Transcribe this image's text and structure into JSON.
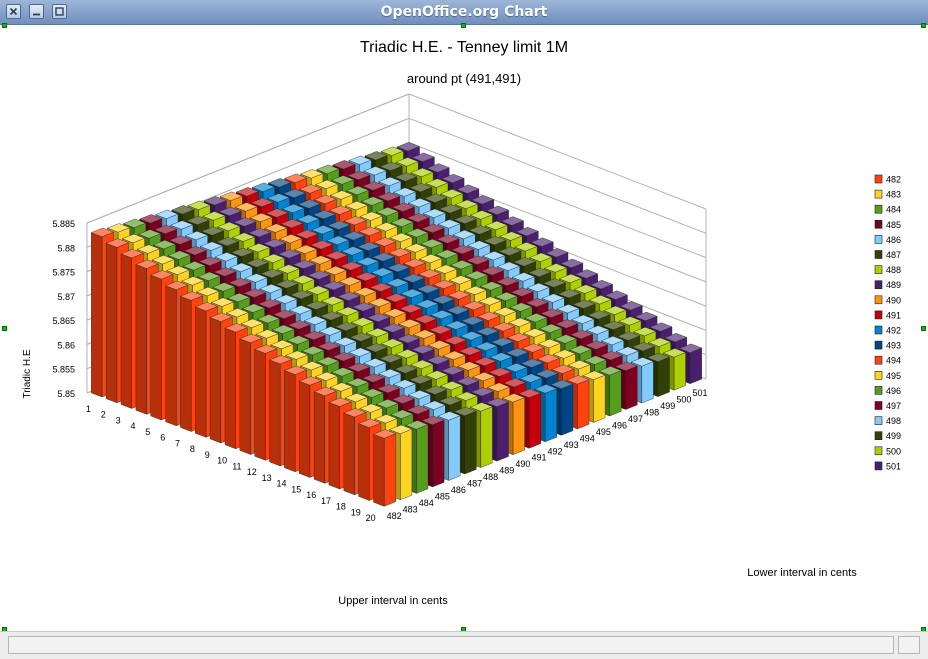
{
  "window": {
    "title": "OpenOffice.org Chart"
  },
  "chart_data": {
    "type": "bar",
    "title": "Triadic H.E. - Tenney limit 1M",
    "subtitle": "around pt (491,491)",
    "ylabel": "Triadic H.E",
    "xlabel": "Upper interval in cents",
    "zlabel": "Lower interval in cents",
    "ylim": [
      5.85,
      5.885
    ],
    "yticks": [
      "5.85",
      "5.855",
      "5.86",
      "5.865",
      "5.87",
      "5.875",
      "5.88",
      "5.885"
    ],
    "rows": [
      "1",
      "2",
      "3",
      "4",
      "5",
      "6",
      "7",
      "8",
      "9",
      "10",
      "11",
      "12",
      "13",
      "14",
      "15",
      "16",
      "17",
      "18",
      "19",
      "20"
    ],
    "series": [
      {
        "name": "482",
        "color": "#ff420e",
        "values": [
          5.883,
          5.882,
          5.881,
          5.88,
          5.879,
          5.878,
          5.877,
          5.876,
          5.875,
          5.874,
          5.873,
          5.872,
          5.871,
          5.87,
          5.869,
          5.868,
          5.867,
          5.866,
          5.865,
          5.864
        ]
      },
      {
        "name": "483",
        "color": "#ffd320",
        "values": [
          5.8826,
          5.8816,
          5.8806,
          5.8796,
          5.8786,
          5.8776,
          5.8766,
          5.8756,
          5.8746,
          5.8736,
          5.8726,
          5.8716,
          5.8706,
          5.8696,
          5.8686,
          5.8676,
          5.8666,
          5.8656,
          5.8646,
          5.8636
        ]
      },
      {
        "name": "484",
        "color": "#579d1c",
        "values": [
          5.8822,
          5.8812,
          5.8802,
          5.8792,
          5.8782,
          5.8772,
          5.8762,
          5.8752,
          5.8742,
          5.8732,
          5.8722,
          5.8712,
          5.8702,
          5.8692,
          5.8682,
          5.8672,
          5.8662,
          5.8652,
          5.8642,
          5.8632
        ]
      },
      {
        "name": "485",
        "color": "#7e0021",
        "values": [
          5.8818,
          5.8808,
          5.8798,
          5.8788,
          5.8778,
          5.8768,
          5.8758,
          5.8748,
          5.8738,
          5.8728,
          5.8718,
          5.8708,
          5.8698,
          5.8688,
          5.8678,
          5.8668,
          5.8658,
          5.8648,
          5.8638,
          5.8628
        ]
      },
      {
        "name": "486",
        "color": "#83caff",
        "values": [
          5.8814,
          5.8804,
          5.8794,
          5.8784,
          5.8774,
          5.8764,
          5.8754,
          5.8744,
          5.8734,
          5.8724,
          5.8714,
          5.8704,
          5.8694,
          5.8684,
          5.8674,
          5.8664,
          5.8654,
          5.8644,
          5.8634,
          5.8624
        ]
      },
      {
        "name": "487",
        "color": "#314004",
        "values": [
          5.881,
          5.88,
          5.879,
          5.878,
          5.877,
          5.876,
          5.875,
          5.874,
          5.873,
          5.872,
          5.871,
          5.87,
          5.869,
          5.868,
          5.867,
          5.866,
          5.865,
          5.864,
          5.863,
          5.862
        ]
      },
      {
        "name": "488",
        "color": "#aecf00",
        "values": [
          5.8806,
          5.8796,
          5.8786,
          5.8776,
          5.8766,
          5.8756,
          5.8746,
          5.8736,
          5.8726,
          5.8716,
          5.8706,
          5.8696,
          5.8686,
          5.8676,
          5.8666,
          5.8656,
          5.8646,
          5.8636,
          5.8626,
          5.8616
        ]
      },
      {
        "name": "489",
        "color": "#4b1f6f",
        "values": [
          5.8802,
          5.8792,
          5.8782,
          5.8772,
          5.8762,
          5.8752,
          5.8742,
          5.8732,
          5.8722,
          5.8712,
          5.8702,
          5.8692,
          5.8682,
          5.8672,
          5.8662,
          5.8652,
          5.8642,
          5.8632,
          5.8622,
          5.8612
        ]
      },
      {
        "name": "490",
        "color": "#ff950e",
        "values": [
          5.8798,
          5.8788,
          5.8778,
          5.8768,
          5.8758,
          5.8748,
          5.8738,
          5.8728,
          5.8718,
          5.8708,
          5.8698,
          5.8688,
          5.8678,
          5.8668,
          5.8658,
          5.8648,
          5.8638,
          5.8628,
          5.8618,
          5.8608
        ]
      },
      {
        "name": "491",
        "color": "#c5000b",
        "values": [
          5.8794,
          5.8784,
          5.8774,
          5.8764,
          5.8754,
          5.8744,
          5.8734,
          5.8724,
          5.8714,
          5.8704,
          5.8694,
          5.8684,
          5.8674,
          5.8664,
          5.8654,
          5.8644,
          5.8634,
          5.8624,
          5.8614,
          5.8604
        ]
      },
      {
        "name": "492",
        "color": "#0084d1",
        "values": [
          5.879,
          5.878,
          5.877,
          5.876,
          5.875,
          5.874,
          5.873,
          5.872,
          5.871,
          5.87,
          5.869,
          5.868,
          5.867,
          5.866,
          5.865,
          5.864,
          5.863,
          5.862,
          5.861,
          5.86
        ]
      },
      {
        "name": "493",
        "color": "#004586",
        "values": [
          5.8786,
          5.8776,
          5.8766,
          5.8756,
          5.8746,
          5.8736,
          5.8726,
          5.8716,
          5.8706,
          5.8696,
          5.8686,
          5.8676,
          5.8666,
          5.8656,
          5.8646,
          5.8636,
          5.8626,
          5.8616,
          5.8606,
          5.8596
        ]
      },
      {
        "name": "494",
        "color": "#ff420e",
        "values": [
          5.8782,
          5.8772,
          5.8762,
          5.8752,
          5.8742,
          5.8732,
          5.8722,
          5.8712,
          5.8702,
          5.8692,
          5.8682,
          5.8672,
          5.8662,
          5.8652,
          5.8642,
          5.8632,
          5.8622,
          5.8612,
          5.8602,
          5.8592
        ]
      },
      {
        "name": "495",
        "color": "#ffd320",
        "values": [
          5.8778,
          5.8768,
          5.8758,
          5.8748,
          5.8738,
          5.8728,
          5.8718,
          5.8708,
          5.8698,
          5.8688,
          5.8678,
          5.8668,
          5.8658,
          5.8648,
          5.8638,
          5.8628,
          5.8618,
          5.8608,
          5.8598,
          5.8588
        ]
      },
      {
        "name": "496",
        "color": "#579d1c",
        "values": [
          5.8774,
          5.8764,
          5.8754,
          5.8744,
          5.8734,
          5.8724,
          5.8714,
          5.8704,
          5.8694,
          5.8684,
          5.8674,
          5.8664,
          5.8654,
          5.8644,
          5.8634,
          5.8624,
          5.8614,
          5.8604,
          5.8594,
          5.8584
        ]
      },
      {
        "name": "497",
        "color": "#7e0021",
        "values": [
          5.877,
          5.876,
          5.875,
          5.874,
          5.873,
          5.872,
          5.871,
          5.87,
          5.869,
          5.868,
          5.867,
          5.866,
          5.865,
          5.864,
          5.863,
          5.862,
          5.861,
          5.86,
          5.859,
          5.858
        ]
      },
      {
        "name": "498",
        "color": "#83caff",
        "values": [
          5.8766,
          5.8756,
          5.8746,
          5.8736,
          5.8726,
          5.8716,
          5.8706,
          5.8696,
          5.8686,
          5.8676,
          5.8666,
          5.8656,
          5.8646,
          5.8636,
          5.8626,
          5.8616,
          5.8606,
          5.8596,
          5.8586,
          5.8576
        ]
      },
      {
        "name": "499",
        "color": "#314004",
        "values": [
          5.8762,
          5.8752,
          5.8742,
          5.8732,
          5.8722,
          5.8712,
          5.8702,
          5.8692,
          5.8682,
          5.8672,
          5.8662,
          5.8652,
          5.8642,
          5.8632,
          5.8622,
          5.8612,
          5.8602,
          5.8592,
          5.8582,
          5.8572
        ]
      },
      {
        "name": "500",
        "color": "#aecf00",
        "values": [
          5.8758,
          5.8748,
          5.8738,
          5.8728,
          5.8718,
          5.8708,
          5.8698,
          5.8688,
          5.8678,
          5.8668,
          5.8658,
          5.8648,
          5.8638,
          5.8628,
          5.8618,
          5.8608,
          5.8598,
          5.8588,
          5.8578,
          5.8568
        ]
      },
      {
        "name": "501",
        "color": "#4b1f6f",
        "values": [
          5.8754,
          5.8744,
          5.8734,
          5.8724,
          5.8714,
          5.8704,
          5.8694,
          5.8684,
          5.8674,
          5.8664,
          5.8654,
          5.8644,
          5.8634,
          5.8624,
          5.8614,
          5.8604,
          5.8594,
          5.8584,
          5.8574,
          5.8564
        ]
      }
    ],
    "legend": "right",
    "grid": true
  }
}
